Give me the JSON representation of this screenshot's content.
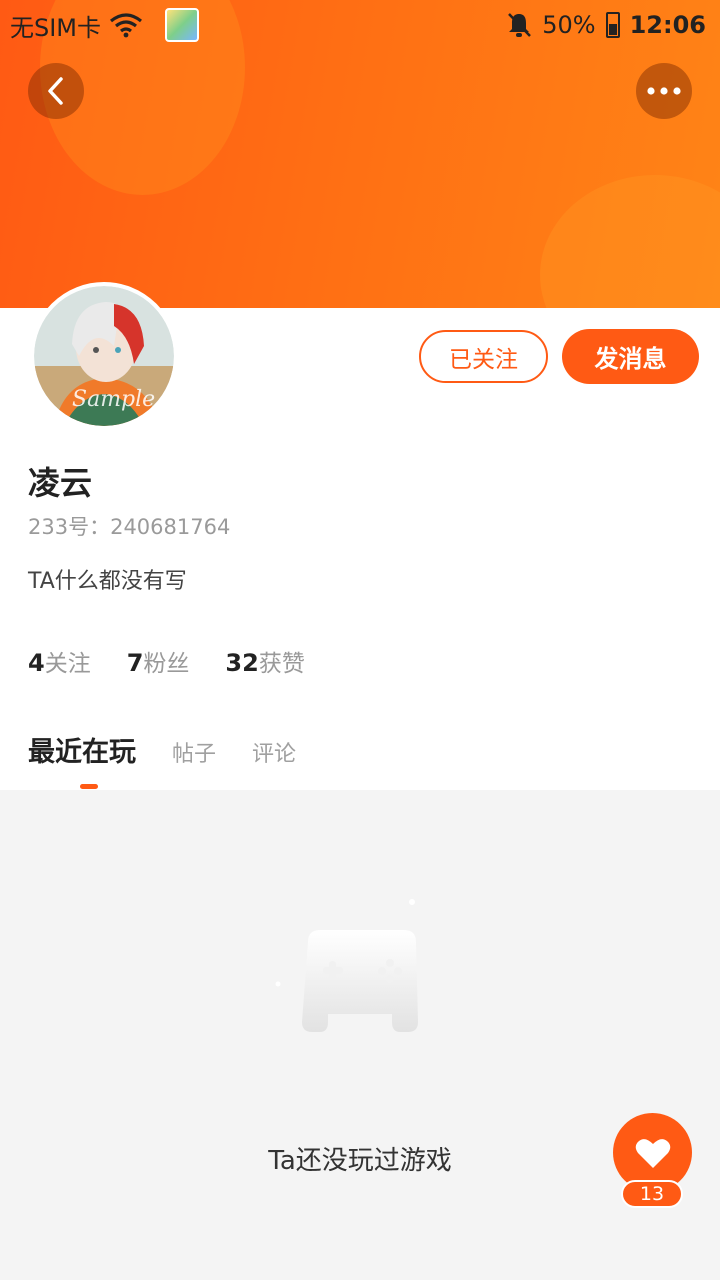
{
  "status_bar": {
    "carrier": "无SIM卡",
    "battery": "50%",
    "time": "12:06"
  },
  "profile": {
    "name": "凌云",
    "id_text": "233号：240681764",
    "bio": "TA什么都没有写",
    "follow_button": "已关注",
    "message_button": "发消息"
  },
  "stats": [
    {
      "num": "4",
      "label": "关注"
    },
    {
      "num": "7",
      "label": "粉丝"
    },
    {
      "num": "32",
      "label": "获赞"
    }
  ],
  "tabs": [
    "最近在玩",
    "帖子",
    "评论"
  ],
  "empty_state": "Ta还没玩过游戏",
  "like_count": "13",
  "colors": {
    "accent": "#ff5a14",
    "header_gradient_end": "#ff8416"
  },
  "icons": [
    "back-arrow-icon",
    "more-dots-icon",
    "gamepad-icon",
    "heart-icon",
    "wifi-icon",
    "mute-bell-icon",
    "battery-icon"
  ]
}
